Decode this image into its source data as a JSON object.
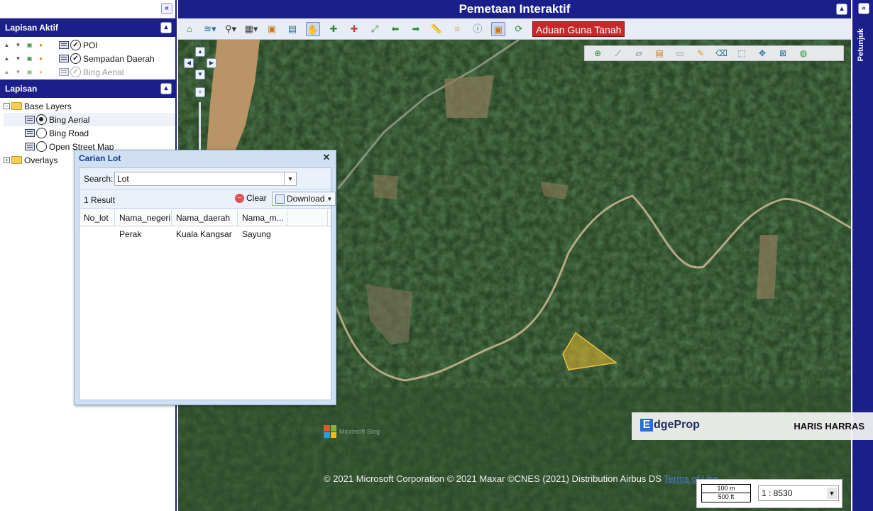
{
  "app": {
    "title": "Pemetaan Interaktif"
  },
  "left_panel": {
    "active_layers": {
      "title": "Lapisan Aktif",
      "items": [
        {
          "label": "POI",
          "checked": true
        },
        {
          "label": "Sempadan Daerah",
          "checked": true
        },
        {
          "label": "Bing Aerial",
          "checked": true,
          "disabled": true
        }
      ]
    },
    "layers": {
      "title": "Lapisan",
      "base_group": "Base Layers",
      "base_items": [
        {
          "label": "Bing Aerial",
          "selected": true
        },
        {
          "label": "Bing Road",
          "selected": false
        },
        {
          "label": "Open Street Map",
          "selected": false
        }
      ],
      "overlays_group": "Overlays"
    }
  },
  "toolbar": {
    "icons": [
      "home-icon",
      "layers-icon",
      "zoom-icon",
      "grid-icon",
      "map-icon",
      "save-icon",
      "pan-icon",
      "zoom-in-icon",
      "zoom-out-icon",
      "full-extent-icon",
      "back-icon",
      "forward-icon",
      "measure-icon",
      "crop-icon",
      "info-icon",
      "select-icon",
      "refresh-icon"
    ],
    "aduan_label": "Aduan Guna Tanah"
  },
  "map_tools": {
    "icons": [
      "add-point-icon",
      "add-line-icon",
      "add-polygon-icon",
      "add-layer-icon",
      "add-label-icon",
      "edit-icon",
      "eraser-icon",
      "select-feature-icon",
      "move-icon",
      "delete-feature-icon",
      "globe-icon"
    ]
  },
  "right_strip": {
    "label": "Petunjuk"
  },
  "dialog": {
    "title": "Carian Lot",
    "search_label": "Search:",
    "search_value": "Lot",
    "result_count": "1 Result",
    "clear_label": "Clear",
    "download_label": "Download",
    "columns": [
      "No_lot",
      "Nama_negeri",
      "Nama_daerah",
      "Nama_m..."
    ],
    "rows": [
      {
        "no_lot": "",
        "negeri": "Perak",
        "daerah": "Kuala Kangsar",
        "mukim": "Sayung"
      }
    ]
  },
  "map": {
    "copyright": "© 2021 Microsoft Corporation © 2021 Maxar ©CNES (2021) Distribution Airbus DS",
    "terms": "Terms of Use",
    "bing_label": "Microsoft Bing",
    "scale_m": "100 m",
    "scale_ft": "500 ft",
    "scale_ratio": "1 : 8530",
    "highlight_color": "#e8b830"
  },
  "watermark": {
    "brand_e": "E",
    "brand_rest": "dgeProp",
    "author": "HARIS HARRAS"
  }
}
